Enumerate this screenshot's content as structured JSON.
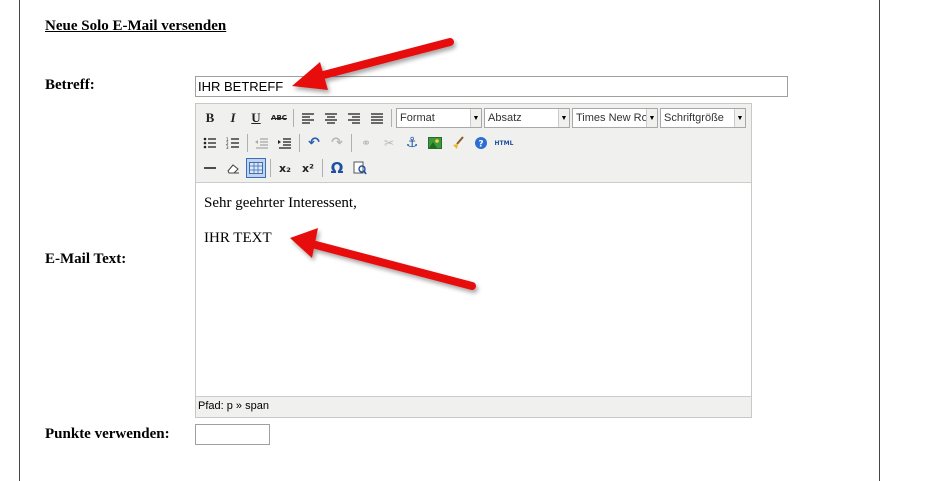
{
  "page": {
    "heading": "Neue Solo E-Mail versenden"
  },
  "form": {
    "subject_label": "Betreff:",
    "subject_value": "IHR BETREFF",
    "email_text_label": "E-Mail Text:",
    "points_label": "Punkte verwenden:",
    "points_value": ""
  },
  "editor": {
    "toolbar": {
      "format_select": "Format",
      "paragraph_select": "Absatz",
      "font_family_select": "Times New Ro",
      "font_size_select": "Schriftgröße",
      "html_button": "HTML"
    },
    "content": {
      "greeting": "Sehr geehrter Interessent,",
      "body": "IHR TEXT"
    },
    "status_path": "Pfad: p » span"
  },
  "colors": {
    "annotation_arrow": "#e81010",
    "toolbar_bg": "#f0f0ee"
  }
}
